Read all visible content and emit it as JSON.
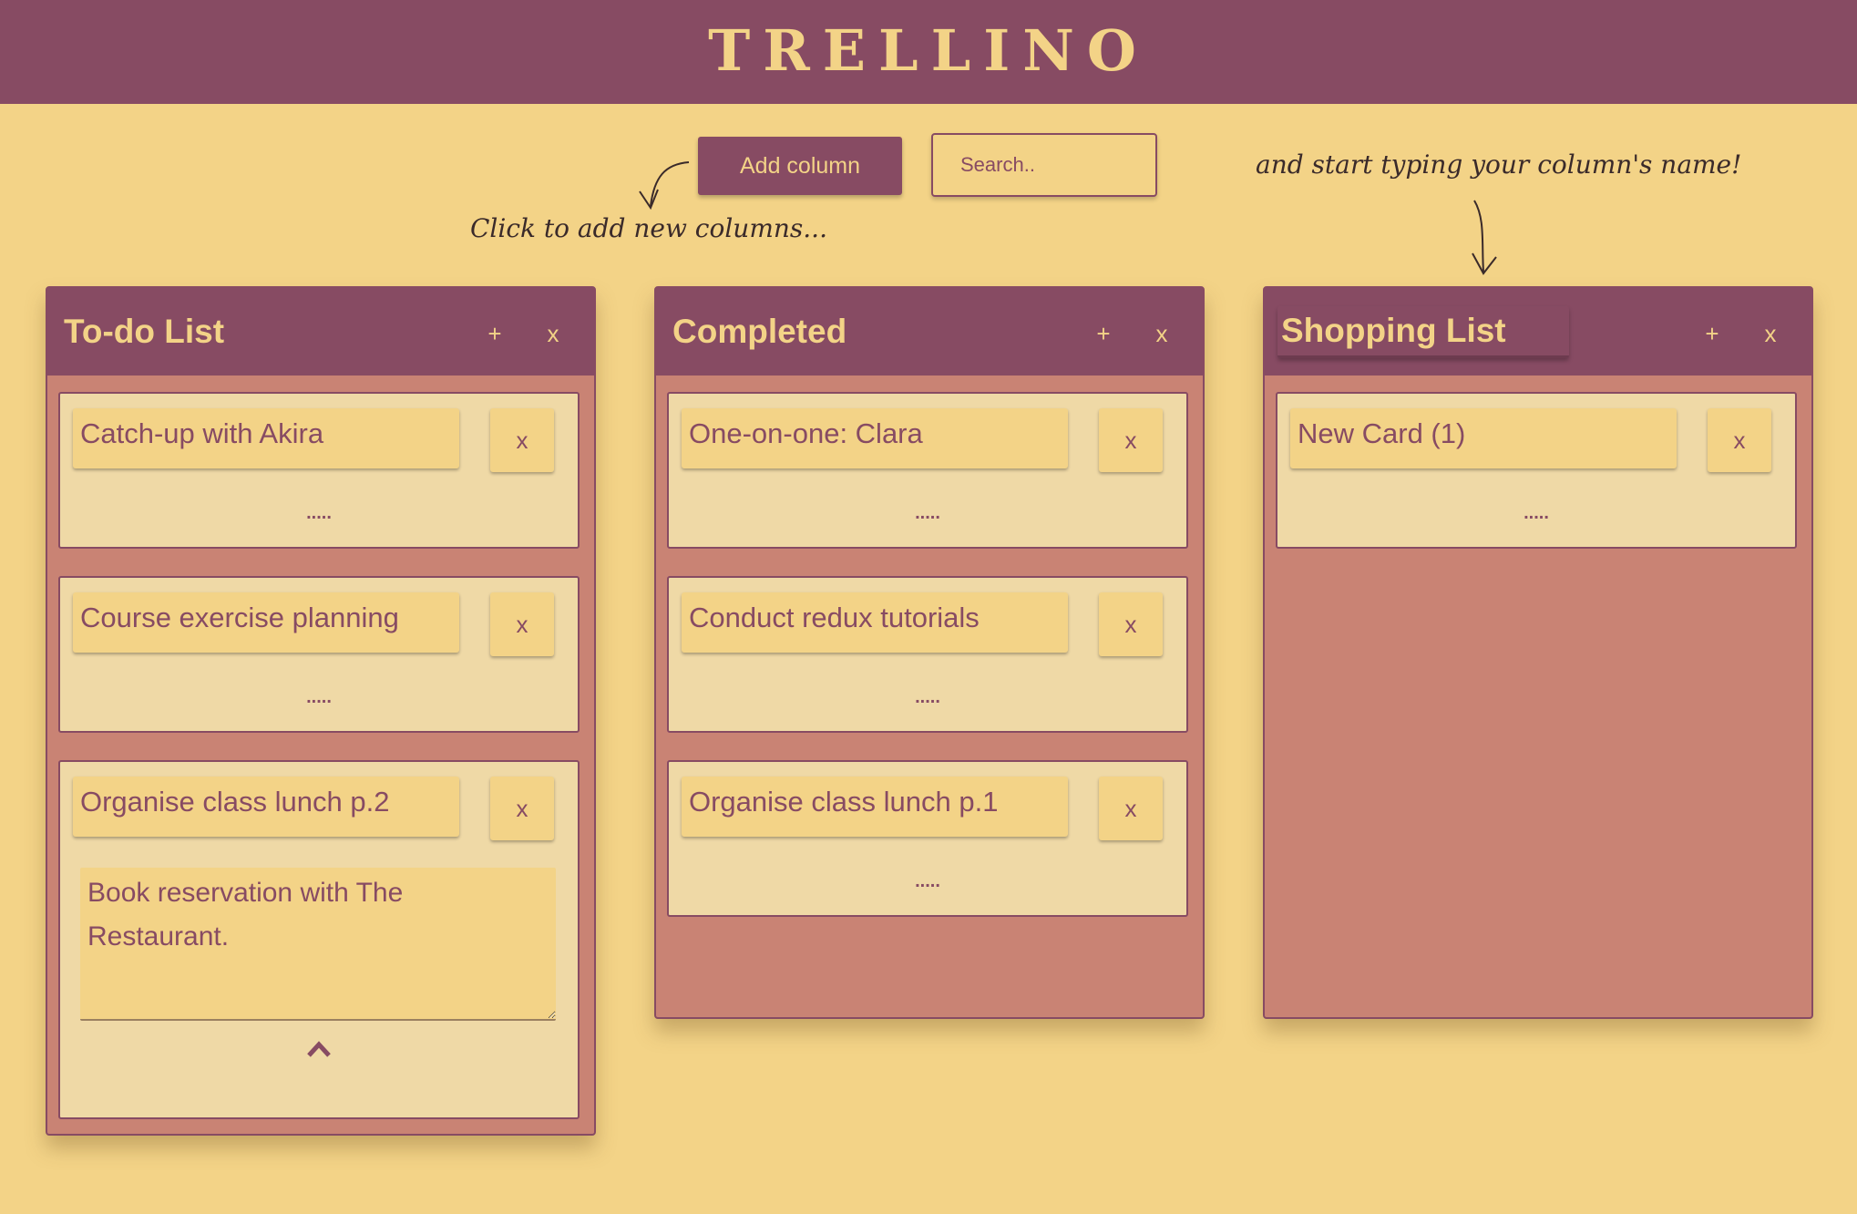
{
  "app": {
    "title": "TRELLINO"
  },
  "toolbar": {
    "add_column_label": "Add column",
    "search_placeholder": "Search.."
  },
  "hints": {
    "add_columns": "Click to add new columns...",
    "start_typing": "and start typing your column's name!"
  },
  "columns": [
    {
      "title": "To-do List",
      "add_label": "+",
      "close_label": "x",
      "cards": [
        {
          "title": "Catch-up with Akira",
          "close_label": "x",
          "more_label": "....."
        },
        {
          "title": "Course exercise planning",
          "close_label": "x",
          "more_label": "....."
        },
        {
          "title": "Organise class lunch p.2",
          "close_label": "x",
          "description": "Book reservation with The Restaurant."
        }
      ]
    },
    {
      "title": "Completed",
      "add_label": "+",
      "close_label": "x",
      "cards": [
        {
          "title": "One-on-one: Clara",
          "close_label": "x",
          "more_label": "....."
        },
        {
          "title": "Conduct redux tutorials",
          "close_label": "x",
          "more_label": "....."
        },
        {
          "title": "Organise class lunch p.1",
          "close_label": "x",
          "more_label": "....."
        }
      ]
    },
    {
      "title": "Shopping List",
      "add_label": "+",
      "close_label": "x",
      "cards": [
        {
          "title": "New Card (1)",
          "close_label": "x",
          "more_label": "....."
        }
      ]
    }
  ],
  "colors": {
    "background": "#f3d387",
    "primary": "#874b63",
    "column_body": "#c98374",
    "card": "#efd9a6"
  }
}
